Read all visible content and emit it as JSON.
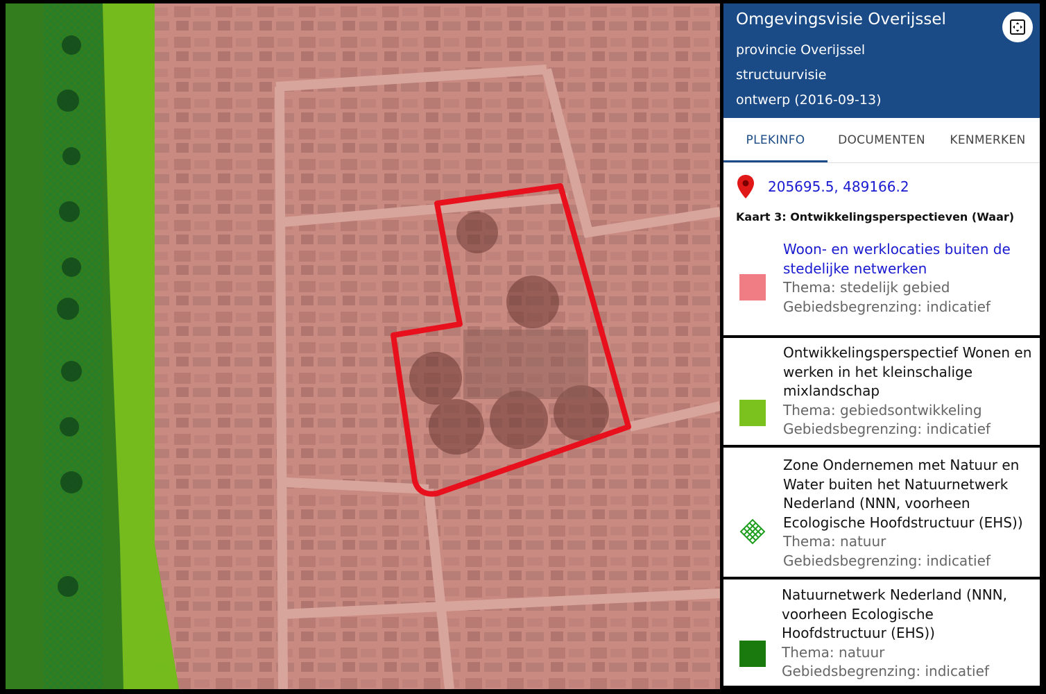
{
  "panel": {
    "title": "Omgevingsvisie Overijssel",
    "lines": [
      "provincie Overijssel",
      "structuurvisie",
      "ontwerp (2016-09-13)"
    ],
    "expand_icon": "expand-icon"
  },
  "tabs": [
    {
      "label": "PLEKINFO",
      "active": true
    },
    {
      "label": "DOCUMENTEN",
      "active": false
    },
    {
      "label": "KENMERKEN",
      "active": false
    }
  ],
  "location": {
    "icon": "map-pin-icon",
    "coordinates": "205695.5, 489166.2"
  },
  "map_title": "Kaart 3: Ontwikkelingsperspectieven (Waar)",
  "legend": [
    {
      "name": "Woon- en werklocaties buiten de stedelijke netwerken",
      "thema": "Thema: stedelijk gebied",
      "begrenzing": "Gebiedsbegrenzing: indicatief",
      "color": "#f07d84",
      "pattern": "solid",
      "is_link": true
    },
    {
      "name": "Ontwikkelingsperspectief Wonen en werken in het kleinschalige mixlandschap",
      "thema": "Thema: gebiedsontwikkeling",
      "begrenzing": "Gebiedsbegrenzing: indicatief",
      "color": "#7cc21e",
      "pattern": "solid",
      "is_link": false
    },
    {
      "name": "Zone Ondernemen met Natuur en Water buiten het Natuurnetwerk Nederland (NNN, voorheen Ecologische Hoofdstructuur (EHS))",
      "thema": "Thema: natuur",
      "begrenzing": "Gebiedsbegrenzing: indicatief",
      "color": "#1e9e1e",
      "pattern": "crosshatch",
      "is_link": false
    },
    {
      "name": "Natuurnetwerk Nederland (NNN, voorheen Ecologische Hoofdstructuur (EHS))",
      "thema": "Thema: natuur",
      "begrenzing": "Gebiedsbegrenzing: indicatief",
      "color": "#1a7a0e",
      "pattern": "solid",
      "is_link": false
    }
  ],
  "map": {
    "selection_color": "#e8101c",
    "urban_overlay_color": "#f07d84",
    "nnn_color": "#1a7a0e",
    "mix_color": "#7cc21e"
  }
}
